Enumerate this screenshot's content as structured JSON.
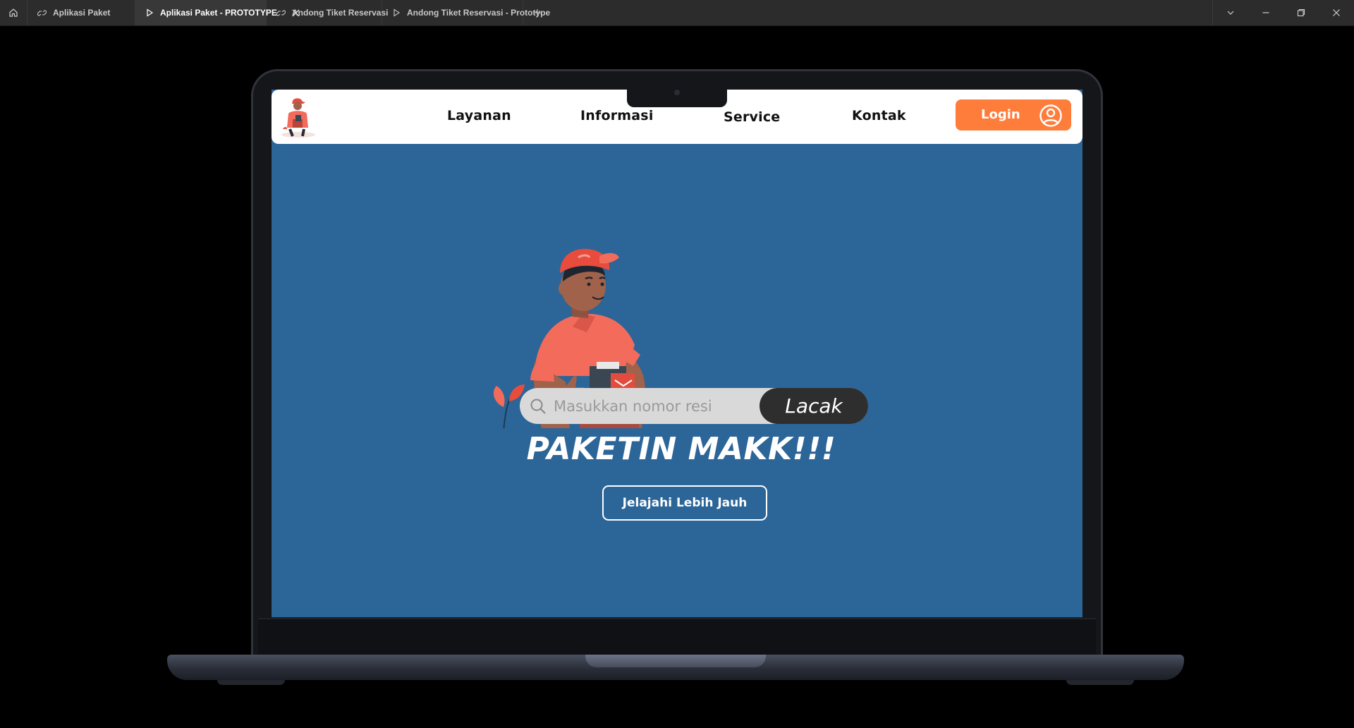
{
  "tabs": [
    {
      "label": "Aplikasi Paket",
      "icon": "figma-link-icon",
      "active": false
    },
    {
      "label": "Aplikasi Paket - PROTOTYPE",
      "icon": "play-icon",
      "active": true
    },
    {
      "label": "Andong Tiket Reservasi",
      "icon": "figma-link-icon",
      "active": false
    },
    {
      "label": "Andong Tiket Reservasi - Prototype",
      "icon": "play-icon",
      "active": false
    }
  ],
  "window_controls": [
    "chevron-down-icon",
    "minimize-icon",
    "restore-icon",
    "close-icon"
  ],
  "navbar": {
    "items": [
      "Layanan",
      "Informasi",
      "Service",
      "Kontak"
    ],
    "login_label": "Login"
  },
  "search": {
    "placeholder": "Masukkan nomor resi",
    "button_label": "Lacak"
  },
  "hero": {
    "headline": "PAKETIN MAKK!!!",
    "cta_label": "Jelajahi Lebih Jauh"
  },
  "colors": {
    "screen_bg": "#2c6598",
    "accent_orange": "#ff7d3b",
    "navbar_bg": "#ffffff",
    "button_dark": "#2e2e2e"
  }
}
